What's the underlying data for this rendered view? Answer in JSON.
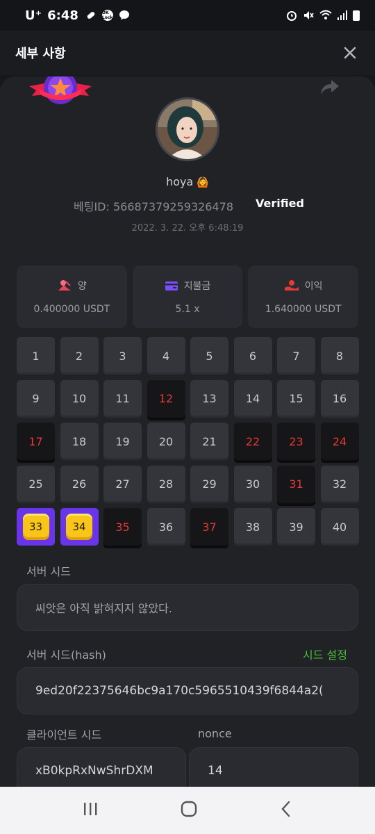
{
  "status_bar": {
    "carrier": "U⁺",
    "time": "6:48",
    "mini_badge": "OK Lock"
  },
  "header": {
    "title": "세부 사항"
  },
  "profile": {
    "username": "hoya",
    "username_emoji": "🙆",
    "bet_id_label": "베팅ID:",
    "bet_id": "56687379259326478",
    "verified": "Verified",
    "timestamp": "2022. 3. 22. 오후 6:48:19"
  },
  "stats": [
    {
      "icon": "bet-icon",
      "label": "양",
      "value": "0.400000 USDT",
      "icon_color": "#e8455a"
    },
    {
      "icon": "card-icon",
      "label": "지불금",
      "value": "5.1 x",
      "icon_color": "#7c4dff"
    },
    {
      "icon": "profit-icon",
      "label": "이익",
      "value": "1.640000 USDT",
      "icon_color": "#e53935"
    }
  ],
  "grid": [
    {
      "n": "1",
      "s": "normal"
    },
    {
      "n": "2",
      "s": "normal"
    },
    {
      "n": "3",
      "s": "normal"
    },
    {
      "n": "4",
      "s": "normal"
    },
    {
      "n": "5",
      "s": "normal"
    },
    {
      "n": "6",
      "s": "normal"
    },
    {
      "n": "7",
      "s": "normal"
    },
    {
      "n": "8",
      "s": "normal"
    },
    {
      "n": "9",
      "s": "normal"
    },
    {
      "n": "10",
      "s": "normal"
    },
    {
      "n": "11",
      "s": "normal"
    },
    {
      "n": "12",
      "s": "hit"
    },
    {
      "n": "13",
      "s": "normal"
    },
    {
      "n": "14",
      "s": "normal"
    },
    {
      "n": "15",
      "s": "normal"
    },
    {
      "n": "16",
      "s": "normal"
    },
    {
      "n": "17",
      "s": "hit"
    },
    {
      "n": "18",
      "s": "normal"
    },
    {
      "n": "19",
      "s": "normal"
    },
    {
      "n": "20",
      "s": "normal"
    },
    {
      "n": "21",
      "s": "normal"
    },
    {
      "n": "22",
      "s": "hit"
    },
    {
      "n": "23",
      "s": "hit"
    },
    {
      "n": "24",
      "s": "hit"
    },
    {
      "n": "25",
      "s": "normal"
    },
    {
      "n": "26",
      "s": "normal"
    },
    {
      "n": "27",
      "s": "normal"
    },
    {
      "n": "28",
      "s": "normal"
    },
    {
      "n": "29",
      "s": "normal"
    },
    {
      "n": "30",
      "s": "normal"
    },
    {
      "n": "31",
      "s": "hit"
    },
    {
      "n": "32",
      "s": "normal"
    },
    {
      "n": "33",
      "s": "pick"
    },
    {
      "n": "34",
      "s": "pick"
    },
    {
      "n": "35",
      "s": "hit"
    },
    {
      "n": "36",
      "s": "normal"
    },
    {
      "n": "37",
      "s": "hit"
    },
    {
      "n": "38",
      "s": "normal"
    },
    {
      "n": "39",
      "s": "normal"
    },
    {
      "n": "40",
      "s": "normal"
    }
  ],
  "server_seed": {
    "label": "서버 시드",
    "value": "씨앗은 아직 밝혀지지 않았다."
  },
  "server_seed_hash": {
    "label": "서버 시드(hash)",
    "link": "시드 설정",
    "value": "9ed20f22375646bc9a170c5965510439f6844a2("
  },
  "client_seed": {
    "label": "클라이언트 시드",
    "value": "xB0kpRxNwShrDXM"
  },
  "nonce": {
    "label": "nonce",
    "value": "14"
  },
  "colors": {
    "accent_green": "#4bbf3a",
    "hit_red": "#e53935",
    "pick_purple": "#6a35e8",
    "gem_yellow": "#f8c51a"
  }
}
